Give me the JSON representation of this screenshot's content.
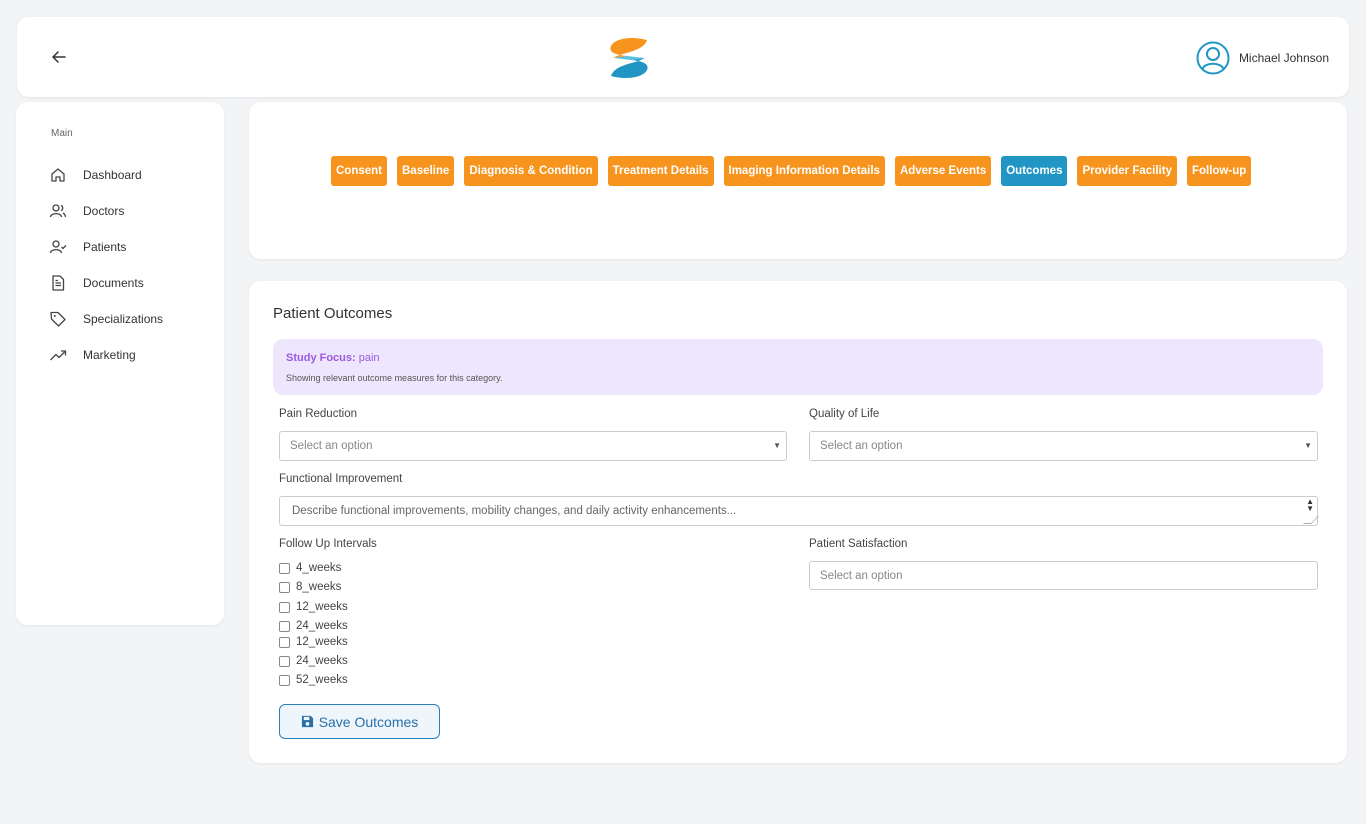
{
  "header": {
    "back_icon": "arrow-left-icon",
    "logo_icon": "s-logo",
    "user_name": "Michael Johnson",
    "user_icon": "user-circle-icon"
  },
  "sidebar": {
    "section": "Main",
    "items": [
      {
        "label": "Dashboard",
        "icon": "home-icon"
      },
      {
        "label": "Doctors",
        "icon": "users-icon"
      },
      {
        "label": "Patients",
        "icon": "user-check-icon"
      },
      {
        "label": "Documents",
        "icon": "document-icon"
      },
      {
        "label": "Specializations",
        "icon": "tag-icon"
      },
      {
        "label": "Marketing",
        "icon": "trending-up-icon"
      }
    ]
  },
  "tabs": [
    {
      "label": "Consent",
      "active": false
    },
    {
      "label": "Baseline",
      "active": false
    },
    {
      "label": "Diagnosis & Condition",
      "active": false
    },
    {
      "label": "Treatment Details",
      "active": false
    },
    {
      "label": "Imaging Information Details",
      "active": false
    },
    {
      "label": "Adverse Events",
      "active": false
    },
    {
      "label": "Outcomes",
      "active": true
    },
    {
      "label": "Provider Facility",
      "active": false
    },
    {
      "label": "Follow-up",
      "active": false
    }
  ],
  "main": {
    "title": "Patient Outcomes",
    "focus": {
      "label": "Study Focus:",
      "value": "pain",
      "subtext": "Showing relevant outcome measures for this category."
    },
    "pain_reduction": {
      "label": "Pain Reduction",
      "placeholder": "Select an option"
    },
    "quality_of_life": {
      "label": "Quality of Life",
      "placeholder": "Select an option"
    },
    "functional_improvement": {
      "label": "Functional Improvement",
      "placeholder": "Describe functional improvements, mobility changes, and daily activity enhancements..."
    },
    "follow_up": {
      "label": "Follow Up Intervals",
      "options": [
        "4_weeks",
        "8_weeks",
        "12_weeks",
        "24_weeks",
        "12_weeks",
        "24_weeks",
        "52_weeks"
      ]
    },
    "patient_satisfaction": {
      "label": "Patient Satisfaction",
      "placeholder": "Select an option"
    },
    "save_label": "Save Outcomes"
  },
  "colors": {
    "tab": "#f7941d",
    "tab_active": "#2196c4",
    "focus_bg": "#ede6fd",
    "focus_text": "#9b59e0",
    "save_border": "#2e7fb8"
  }
}
